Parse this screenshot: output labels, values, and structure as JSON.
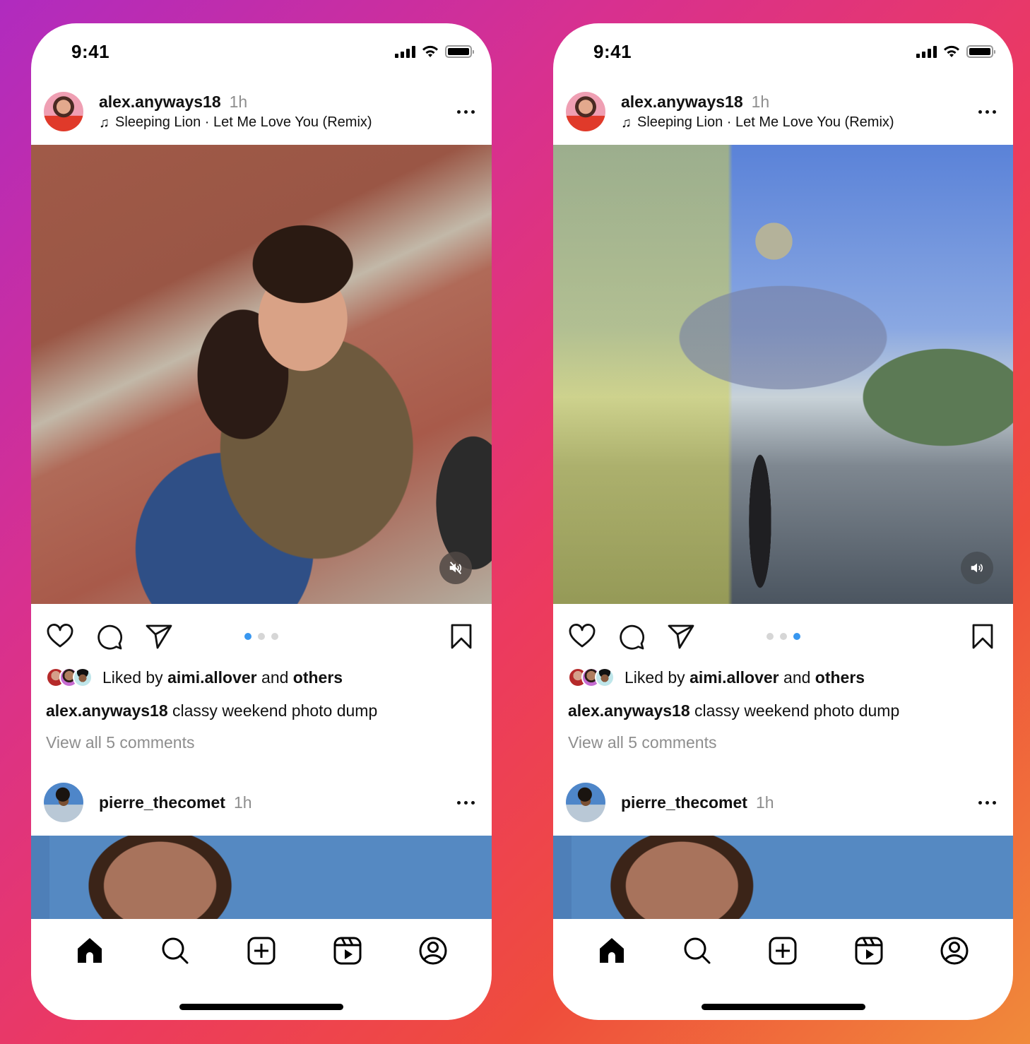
{
  "background": {
    "gradient_colors": [
      "#b02bbf",
      "#d8308f",
      "#ec3a5f",
      "#ef4d3c",
      "#f08a3a"
    ]
  },
  "phones": [
    {
      "id": "left",
      "status_bar": {
        "time": "9:41",
        "signal_icon": "cellular-signal-icon",
        "wifi_icon": "wifi-icon",
        "battery_icon": "battery-full-icon"
      },
      "post": {
        "username": "alex.anyways18",
        "time_ago": "1h",
        "music_icon": "music-note-icon",
        "music": "Sleeping Lion · Let Me Love You (Remix)",
        "media_description": "Selfie of two women hugging on brick steps",
        "audio_state": "muted",
        "audio_icon": "speaker-muted-icon",
        "carousel": {
          "count": 3,
          "active_index": 0
        },
        "liked_prefix": "Liked by",
        "liked_user": "aimi.allover",
        "liked_and": "and",
        "liked_others": "others",
        "caption_user": "alex.anyways18",
        "caption_text": "classy weekend photo dump",
        "comments_link": "View all 5 comments"
      },
      "next_post": {
        "username": "pierre_thecomet",
        "time_ago": "1h"
      }
    },
    {
      "id": "right",
      "status_bar": {
        "time": "9:41",
        "signal_icon": "cellular-signal-icon",
        "wifi_icon": "wifi-icon",
        "battery_icon": "battery-full-icon"
      },
      "post": {
        "username": "alex.anyways18",
        "time_ago": "1h",
        "music_icon": "music-note-icon",
        "music": "Sleeping Lion · Let Me Love You (Remix)",
        "media_description": "Double-exposure video of roller skater at a skatepark",
        "audio_state": "on",
        "audio_icon": "speaker-on-icon",
        "carousel": {
          "count": 3,
          "active_index": 2
        },
        "liked_prefix": "Liked by",
        "liked_user": "aimi.allover",
        "liked_and": "and",
        "liked_others": "others",
        "caption_user": "alex.anyways18",
        "caption_text": "classy weekend photo dump",
        "comments_link": "View all 5 comments"
      },
      "next_post": {
        "username": "pierre_thecomet",
        "time_ago": "1h"
      }
    }
  ],
  "tab_bar": [
    {
      "name": "home",
      "icon": "home-icon",
      "active": true
    },
    {
      "name": "search",
      "icon": "search-icon",
      "active": false
    },
    {
      "name": "create",
      "icon": "plus-square-icon",
      "active": false
    },
    {
      "name": "reels",
      "icon": "reels-icon",
      "active": false
    },
    {
      "name": "profile",
      "icon": "profile-icon",
      "active": false
    }
  ],
  "colors": {
    "accent_dot": "#3897f0",
    "inactive_dot": "#d6d6d6",
    "secondary_text": "#8e8e8e"
  }
}
